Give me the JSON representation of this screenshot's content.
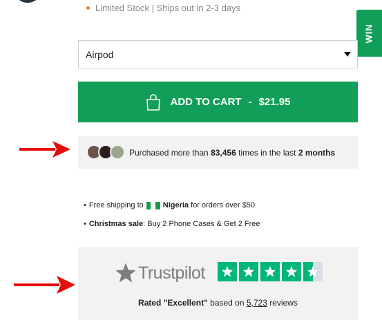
{
  "stock": {
    "text": "Limited Stock | Ships out in 2-3 days"
  },
  "win_tab": {
    "label": "WIN"
  },
  "model_select": {
    "value": "Airpod"
  },
  "add_to_cart": {
    "label": "ADD TO CART",
    "separator": "-",
    "price": "$21.95"
  },
  "social_proof": {
    "prefix": "Purchased more than",
    "count": "83,456",
    "middle": "times in the last",
    "period": "2 months"
  },
  "perks": [
    {
      "bullet": "•",
      "before": "Free shipping to",
      "country": "Nigeria",
      "after": "for orders over $50"
    },
    {
      "bullet": "•",
      "bold": "Christmas sale",
      "after": ": Buy 2 Phone Cases & Get 2 Free"
    }
  ],
  "trustpilot": {
    "brand": "Trustpilot",
    "rating_word": "Rated \"Excellent\"",
    "based_on": "based on",
    "review_count": "5,723",
    "reviews_label": "reviews",
    "stars": 4.5
  },
  "colors": {
    "brand_green": "#109e58",
    "trustpilot_green": "#00b67a",
    "arrow_red": "#e50c0c",
    "stock_dot": "#e28a25"
  }
}
